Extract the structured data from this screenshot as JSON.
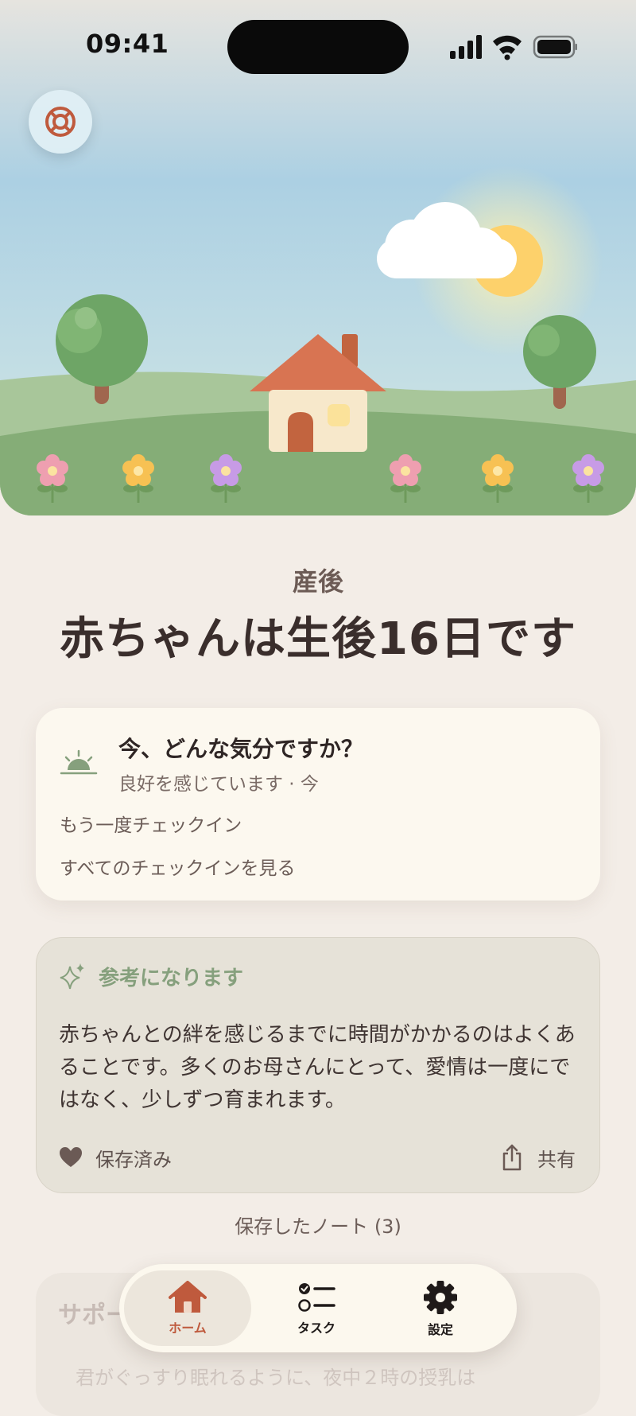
{
  "status_bar": {
    "time": "09:41"
  },
  "hero": {
    "support_button": "lifebuoy-icon"
  },
  "heading": {
    "subtitle": "産後",
    "title": "赤ちゃんは生後16日です"
  },
  "mood_card": {
    "icon": "sunrise-icon",
    "question": "今、どんな気分ですか？",
    "status": "良好を感じています · 今",
    "checkin_again": "もう一度チェックイン",
    "view_all": "すべてのチェックインを見る"
  },
  "tip_card": {
    "label": "参考になります",
    "body": "赤ちゃんとの絆を感じるまでに時間がかかるのはよくあることです。多くのお母さんにとって、愛情は一度にではなく、少しずつ育まれます。",
    "saved_label": "保存済み",
    "share_label": "共有"
  },
  "saved_notes": "保存したノート (3)",
  "support_card": {
    "title": "サポート",
    "text": "君がぐっすり眠れるように、夜中２時の授乳は"
  },
  "tabbar": {
    "home": "ホーム",
    "tasks": "タスク",
    "settings": "設定",
    "active": "home"
  },
  "colors": {
    "accent": "#bf5a3d",
    "tip_accent": "#86a07d",
    "background": "#f3ede7"
  }
}
